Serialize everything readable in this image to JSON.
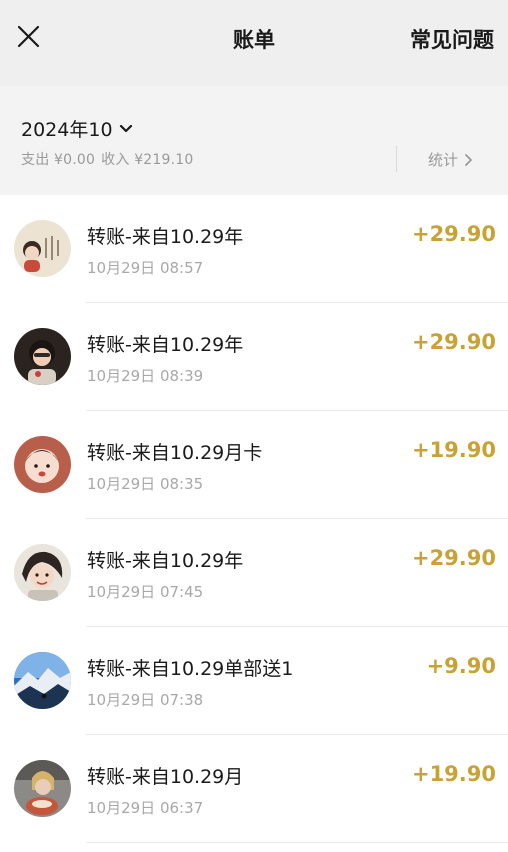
{
  "header": {
    "close_icon": "close-icon",
    "title": "账单",
    "faq_label": "常见问题"
  },
  "summary": {
    "month_label": "2024年10",
    "month_icon": "chevron-down-icon",
    "expense_text": "支出 ¥0.00",
    "income_text": "收入 ¥219.10",
    "stats_label": "统计",
    "stats_icon": "chevron-right-icon"
  },
  "colors": {
    "amount": "#c9a233",
    "header_bg": "#efefef",
    "summary_bg": "#f3f3f3"
  },
  "transactions": [
    {
      "title": "转账-来自10.29年",
      "time": "10月29日 08:57",
      "amount": "+29.90"
    },
    {
      "title": "转账-来自10.29年",
      "time": "10月29日 08:39",
      "amount": "+29.90"
    },
    {
      "title": "转账-来自10.29月卡",
      "time": "10月29日 08:35",
      "amount": "+19.90"
    },
    {
      "title": "转账-来自10.29年",
      "time": "10月29日 07:45",
      "amount": "+29.90"
    },
    {
      "title": "转账-来自10.29单部送1",
      "time": "10月29日 07:38",
      "amount": "+9.90"
    },
    {
      "title": "转账-来自10.29月",
      "time": "10月29日 06:37",
      "amount": "+19.90"
    }
  ]
}
